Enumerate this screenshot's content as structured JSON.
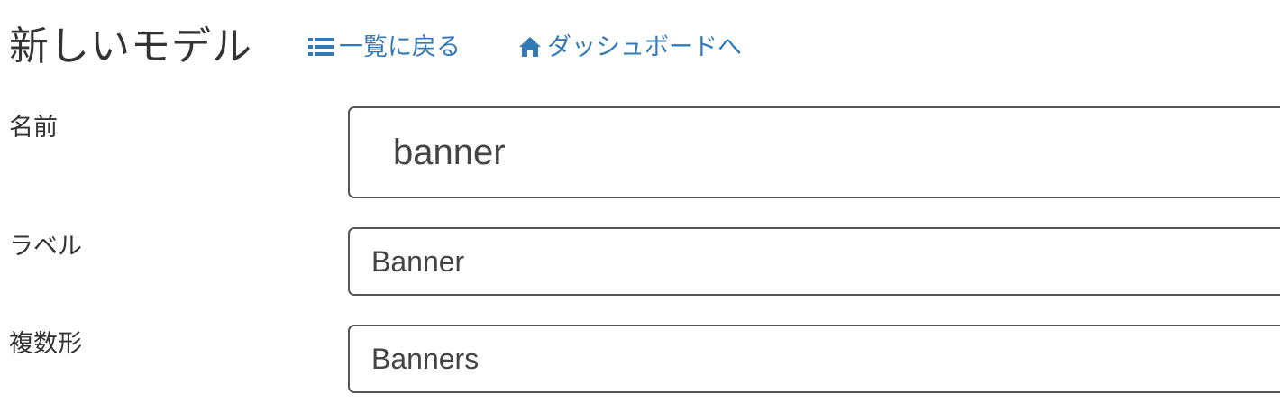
{
  "header": {
    "title": "新しいモデル",
    "back_link": {
      "icon": "list-icon",
      "label": "一覧に戻る"
    },
    "dashboard_link": {
      "icon": "home-icon",
      "label": "ダッシュボードへ"
    },
    "link_color": "#337ab7"
  },
  "form": {
    "name": {
      "label": "名前",
      "value": "banner"
    },
    "label": {
      "label": "ラベル",
      "value": "Banner"
    },
    "plural": {
      "label": "複数形",
      "value": "Banners"
    }
  }
}
